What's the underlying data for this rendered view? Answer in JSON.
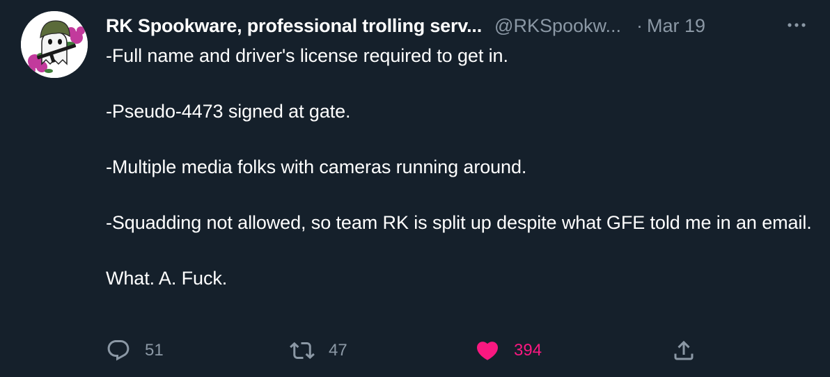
{
  "tweet": {
    "display_name": "RK Spookware, professional trolling serv...",
    "handle": "@RKSpookw...",
    "separator": "·",
    "date": "Mar 19",
    "avatar_icon": "ghost-soldier-avatar",
    "more_icon": "more-horizontal-icon",
    "paragraphs": [
      "-Full name and driver's license required to get in.",
      "-Pseudo-4473 signed at gate.",
      "-Multiple media folks with cameras running around.",
      "-Squadding not allowed, so team RK is split up despite what GFE told me in an email.",
      "What. A. Fuck."
    ],
    "actions": {
      "reply": {
        "icon": "reply-icon",
        "count": "51"
      },
      "retweet": {
        "icon": "retweet-icon",
        "count": "47"
      },
      "like": {
        "icon": "heart-icon",
        "count": "394",
        "color": "#f91880",
        "liked": true
      },
      "share": {
        "icon": "share-icon"
      }
    }
  },
  "colors": {
    "background": "#15202b",
    "text": "#ffffff",
    "muted": "#8b98a5",
    "like": "#f91880"
  }
}
